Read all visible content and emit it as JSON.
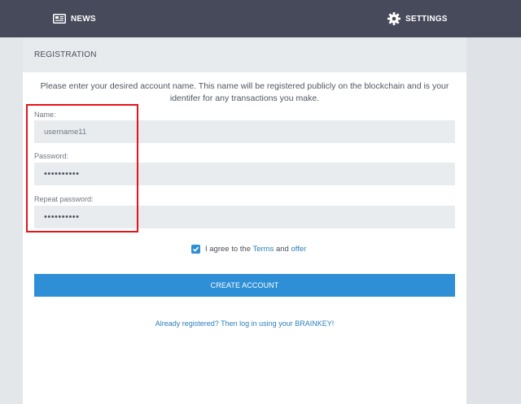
{
  "nav": {
    "news_label": "NEWS",
    "settings_label": "SETTINGS"
  },
  "panel": {
    "title": "REGISTRATION"
  },
  "intro": {
    "text": "Please enter your desired account name. This name will be registered publicly on the blockchain and is your identifer for any transactions you make."
  },
  "form": {
    "name_label": "Name:",
    "name_value": "username11",
    "password_label": "Password:",
    "password_value": "••••••••••",
    "repeat_label": "Repeat password:",
    "repeat_value": "••••••••••",
    "agree_checked": true,
    "agree_prefix": "I agree to the",
    "terms_link": "Terms",
    "agree_and": "and",
    "offer_link": "offer"
  },
  "buttons": {
    "create_account": "CREATE ACCOUNT"
  },
  "login": {
    "link_text": "Already registered? Then log in using your BRAINKEY!"
  },
  "colors": {
    "topbar": "#464a5a",
    "accent": "#2e8fd6",
    "highlight": "#e3141b",
    "link": "#2b7fb8"
  }
}
